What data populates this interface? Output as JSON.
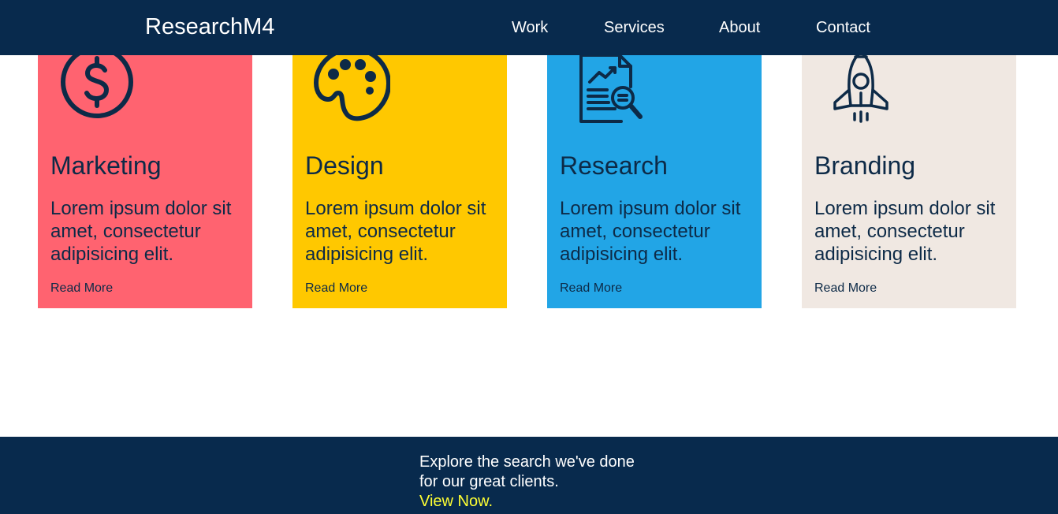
{
  "header": {
    "brand": "ResearchM4",
    "nav": [
      {
        "label": "Work"
      },
      {
        "label": "Services"
      },
      {
        "label": "About"
      },
      {
        "label": "Contact"
      }
    ]
  },
  "cards": [
    {
      "title": "Marketing",
      "description": "Lorem ipsum dolor sit amet, consectetur adipisicing elit.",
      "link": "Read More",
      "icon": "dollar-circle-icon",
      "color": "#ff6370"
    },
    {
      "title": "Design",
      "description": "Lorem ipsum dolor sit amet, consectetur adipisicing elit.",
      "link": "Read More",
      "icon": "palette-icon",
      "color": "#ffc800"
    },
    {
      "title": "Research",
      "description": "Lorem ipsum dolor sit amet, consectetur adipisicing elit.",
      "link": "Read More",
      "icon": "report-search-icon",
      "color": "#22a5e6"
    },
    {
      "title": "Branding",
      "description": "Lorem ipsum dolor sit amet, consectetur adipisicing elit.",
      "link": "Read More",
      "icon": "rocket-icon",
      "color": "#f0e8e2"
    }
  ],
  "cta": {
    "text": "Explore the search we've done for our great clients.",
    "link": "View Now."
  },
  "colors": {
    "navy": "#082a4d",
    "text_dark": "#0d2a47",
    "accent_yellow": "#ffff33"
  }
}
